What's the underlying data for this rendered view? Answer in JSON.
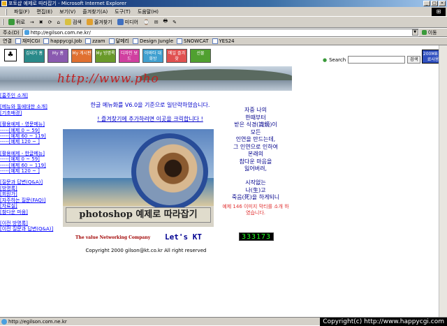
{
  "window": {
    "title": "포토샵 예제로 따라잡기 - Microsoft Internet Explorer",
    "min": "_",
    "max": "□",
    "close": "×"
  },
  "menu": [
    "파일(F)",
    "편집(E)",
    "보기(V)",
    "즐겨찾기(A)",
    "도구(T)",
    "도움말(H)"
  ],
  "toolbar": [
    "뒤로",
    "→",
    "✖",
    "⟳",
    "⌂",
    "검색",
    "즐겨찾기",
    "미디어",
    "⌚",
    "✉",
    "🖶",
    "✎"
  ],
  "address": {
    "label": "주소(D)",
    "url": "http://egilson.com.ne.kr/",
    "go": "이동"
  },
  "links": {
    "label": "연결",
    "items": [
      "재미CGI",
      "happycgi.Job",
      "zzam",
      "달메리",
      "Design Jungle",
      "SNOWCAT",
      "YES24"
    ]
  },
  "site": {
    "nav": [
      {
        "label": "김내가 홈",
        "color": "#2a8a8a"
      },
      {
        "label": "My 홈",
        "color": "#8a5ab0"
      },
      {
        "label": "My 게시판",
        "color": "#e07030"
      },
      {
        "label": "My 방명록",
        "color": "#6a9a2a"
      },
      {
        "label": "디자인 보드",
        "color": "#d040a0"
      },
      {
        "label": "아바타 대화방",
        "color": "#40a0d0"
      },
      {
        "label": "메일 즐겨찾",
        "color": "#e05050"
      },
      {
        "label": "선물",
        "color": "#50a030"
      }
    ],
    "home_icon": "♣",
    "search_label": "Search",
    "search_button": "검색",
    "free_button": "200MB 무료사용",
    "banner_text": "http://www.pho",
    "sidebar": [
      "[홈주인 소개]",
      "",
      "[메뉴와 툴에대한 소개]",
      "[기초배경]",
      "",
      "[활용예제 - 영문메뉴]",
      "-----[예제 0 ~ 59]",
      "-----[예제 60 ~ 119]",
      "-----[예제 120 ~ ]",
      "",
      "[활용예제 - 한글메뉴]",
      "-----[예제 0 ~ 59]",
      "-----[예제 60 ~ 119]",
      "-----[예제 120 ~ ]",
      "",
      "[질문과 답변(Q&A)]",
      "[방명록]",
      "[회원가]",
      "[자주하는 질문(FAQ)]",
      "[자료실]",
      "[참다운 마음]",
      "",
      "[이전 방명록]",
      "[이전 질문과 답변(Q&A)]"
    ],
    "notice": "한글 메뉴화를 V6.0을 기준으로 일단락하였습니다.",
    "bookmark": "! 즐겨찾기에 추가하려면 이곳을 크릭합니다 !",
    "photo_caption": "photoshop 예제로 따라잡기",
    "poem1": [
      "자중 나의",
      "한때부터",
      "받은 식경(識鏡)이",
      "모든",
      "인연을 만드는데,",
      "그 인연으로 인하여",
      "본래의",
      "참다운 마음을",
      "잃어버려,"
    ],
    "poem2": [
      "시작없는",
      "나(生)고",
      "죽음(死)을 하게되니"
    ],
    "poem_note": "예제 146 이미지 막티를 소개 하였습니다.",
    "footer_company": "The value Networking Company",
    "footer_kt": "Let's KT",
    "counter": "333173",
    "copyright": "Copyright 2000 gilson@kt.co.kr All right reserved"
  },
  "status": {
    "url": "http://egilson.com.ne.kr",
    "copyright": "Copyright(c) http://www.happycgi.com"
  }
}
